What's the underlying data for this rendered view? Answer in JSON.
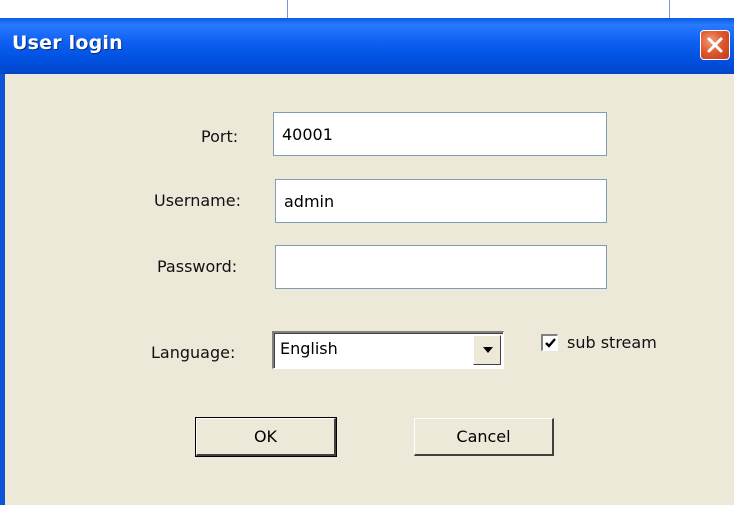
{
  "window": {
    "title": "User login",
    "close_icon": "close-icon",
    "accent_color": "#0b5ff0",
    "close_color": "#e05a2f"
  },
  "form": {
    "port_label": "Port:",
    "port_value": "40001",
    "username_label": "Username:",
    "username_value": "admin",
    "password_label": "Password:",
    "password_value": "",
    "language_label": "Language:",
    "language_value": "English",
    "sub_stream_label": "sub stream",
    "sub_stream_checked": true
  },
  "buttons": {
    "ok_label": "OK",
    "cancel_label": "Cancel"
  }
}
